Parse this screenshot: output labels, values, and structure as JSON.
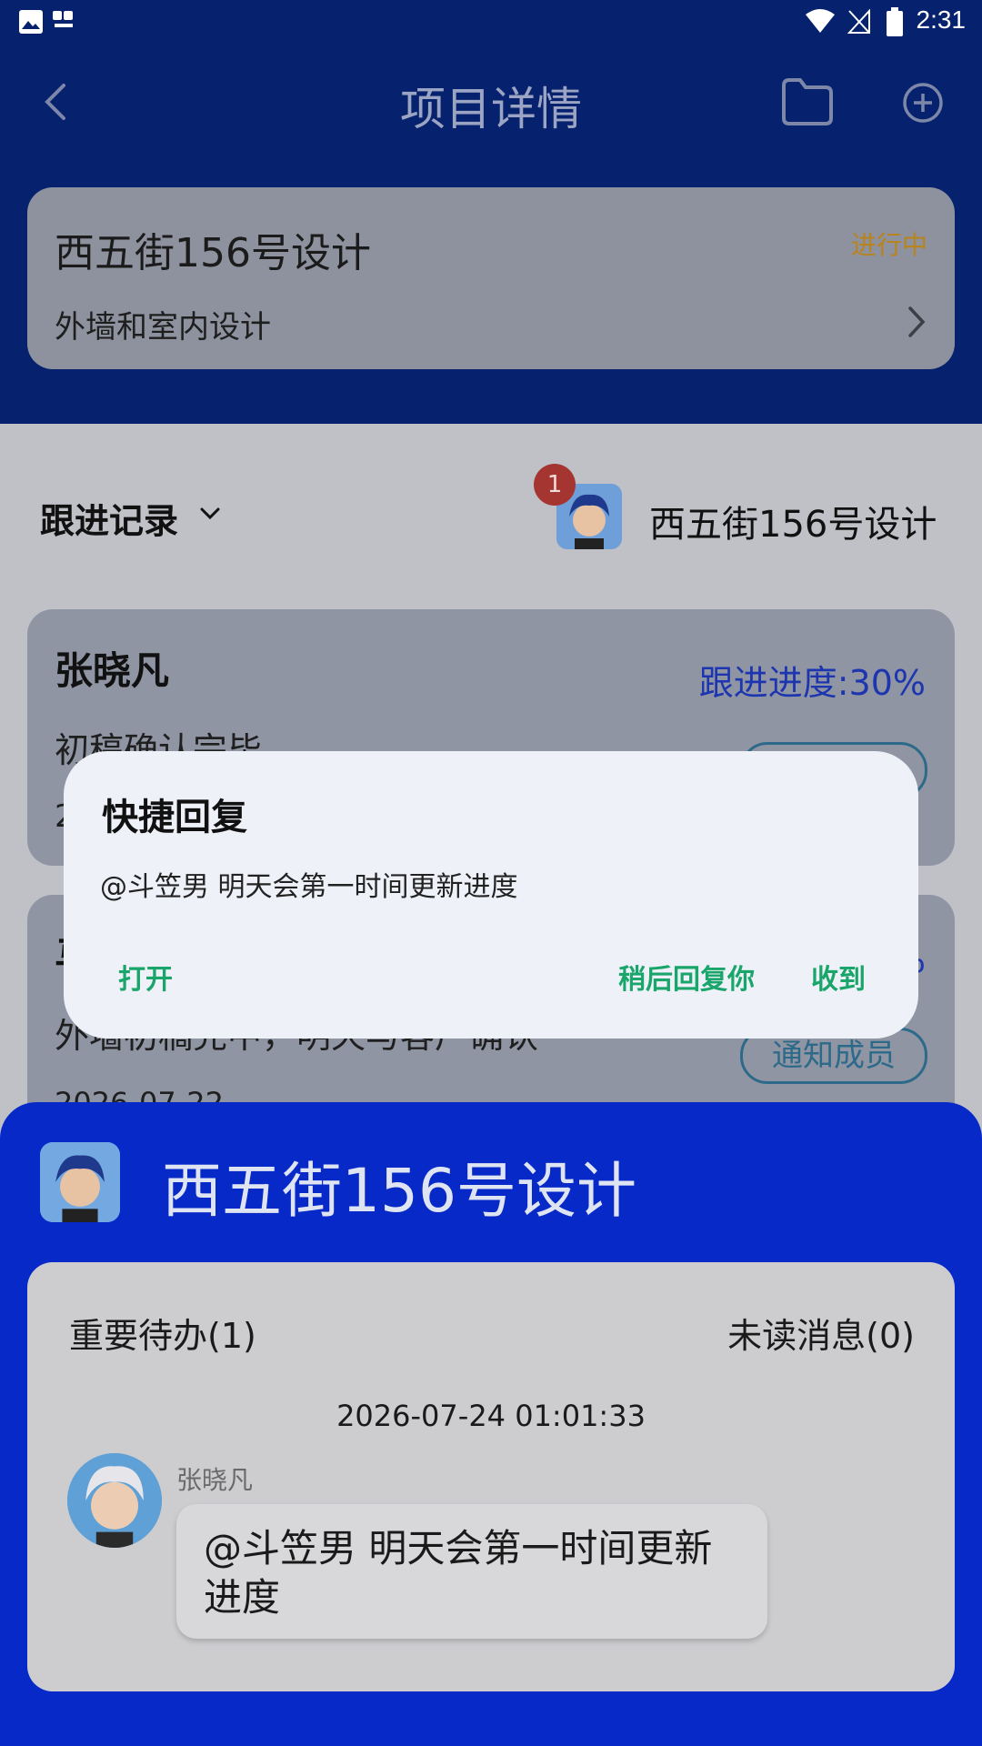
{
  "status_bar": {
    "time": "2:31"
  },
  "header": {
    "title": "项目详情"
  },
  "project": {
    "name": "西五街156号设计",
    "status": "进行中",
    "description": "外墙和室内设计"
  },
  "follow": {
    "label": "跟进记录",
    "group_name": "西五街156号设计",
    "badge": "1"
  },
  "records": [
    {
      "name": "张晓凡",
      "progress": "跟进进度:30%",
      "note": "初稿确认完毕",
      "date": "2",
      "button": ""
    },
    {
      "name": "马",
      "progress": "%",
      "note": "外墙初稿完中，明天与客户确认",
      "date": "2026-07-22",
      "button": "通知成员"
    }
  ],
  "dialog": {
    "title": "快捷回复",
    "message": "@斗笠男 明天会第一时间更新进度",
    "open": "打开",
    "later": "稍后回复你",
    "received": "收到"
  },
  "sheet": {
    "title": "西五街156号设计",
    "todo": "重要待办(1)",
    "unread": "未读消息(0)",
    "time": "2026-07-24 01:01:33",
    "sender": "张晓凡",
    "message": "@斗笠男 明天会第一时间更新进度"
  }
}
